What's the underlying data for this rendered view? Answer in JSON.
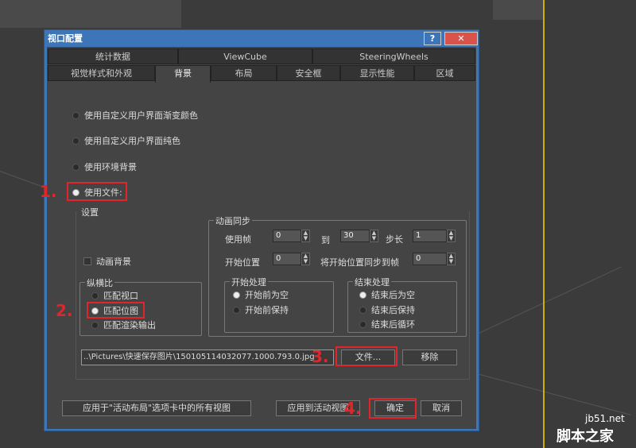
{
  "dialog": {
    "title": "视口配置",
    "help": "?",
    "close": "✕"
  },
  "tabs_row1": [
    "统计数据",
    "ViewCube",
    "SteeringWheels"
  ],
  "tabs_row2": [
    "视觉样式和外观",
    "背景",
    "布局",
    "安全框",
    "显示性能",
    "区域"
  ],
  "bg_options": [
    "使用自定义用户界面渐变颜色",
    "使用自定义用户界面纯色",
    "使用环境背景",
    "使用文件:"
  ],
  "settings": {
    "label": "设置",
    "animate_bg": "动画背景",
    "aspect": {
      "label": "纵横比",
      "options": [
        "匹配视口",
        "匹配位图",
        "匹配渲染输出"
      ]
    },
    "anim": {
      "label": "动画同步",
      "use_frames": "使用帧",
      "from": "0",
      "to_label": "到",
      "to": "30",
      "step_label": "步长",
      "step": "1",
      "start_pos": "开始位置",
      "start_val": "0",
      "sync_label": "将开始位置同步到帧",
      "sync_val": "0",
      "start_proc": {
        "label": "开始处理",
        "options": [
          "开始前为空",
          "开始前保持"
        ]
      },
      "end_proc": {
        "label": "结束处理",
        "options": [
          "结束后为空",
          "结束后保持",
          "结束后循环"
        ]
      }
    }
  },
  "file_path": "..\\Pictures\\快速保存图片\\150105114032077.1000.793.0.jpg",
  "buttons": {
    "files": "文件...",
    "remove": "移除",
    "apply_all": "应用于\"活动布局\"选项卡中的所有视图",
    "apply_active": "应用到活动视图",
    "ok": "确定",
    "cancel": "取消"
  },
  "steps": [
    "1.",
    "2.",
    "3.",
    "4."
  ],
  "watermark": {
    "site": "jb51.net",
    "name": "脚本之家"
  }
}
